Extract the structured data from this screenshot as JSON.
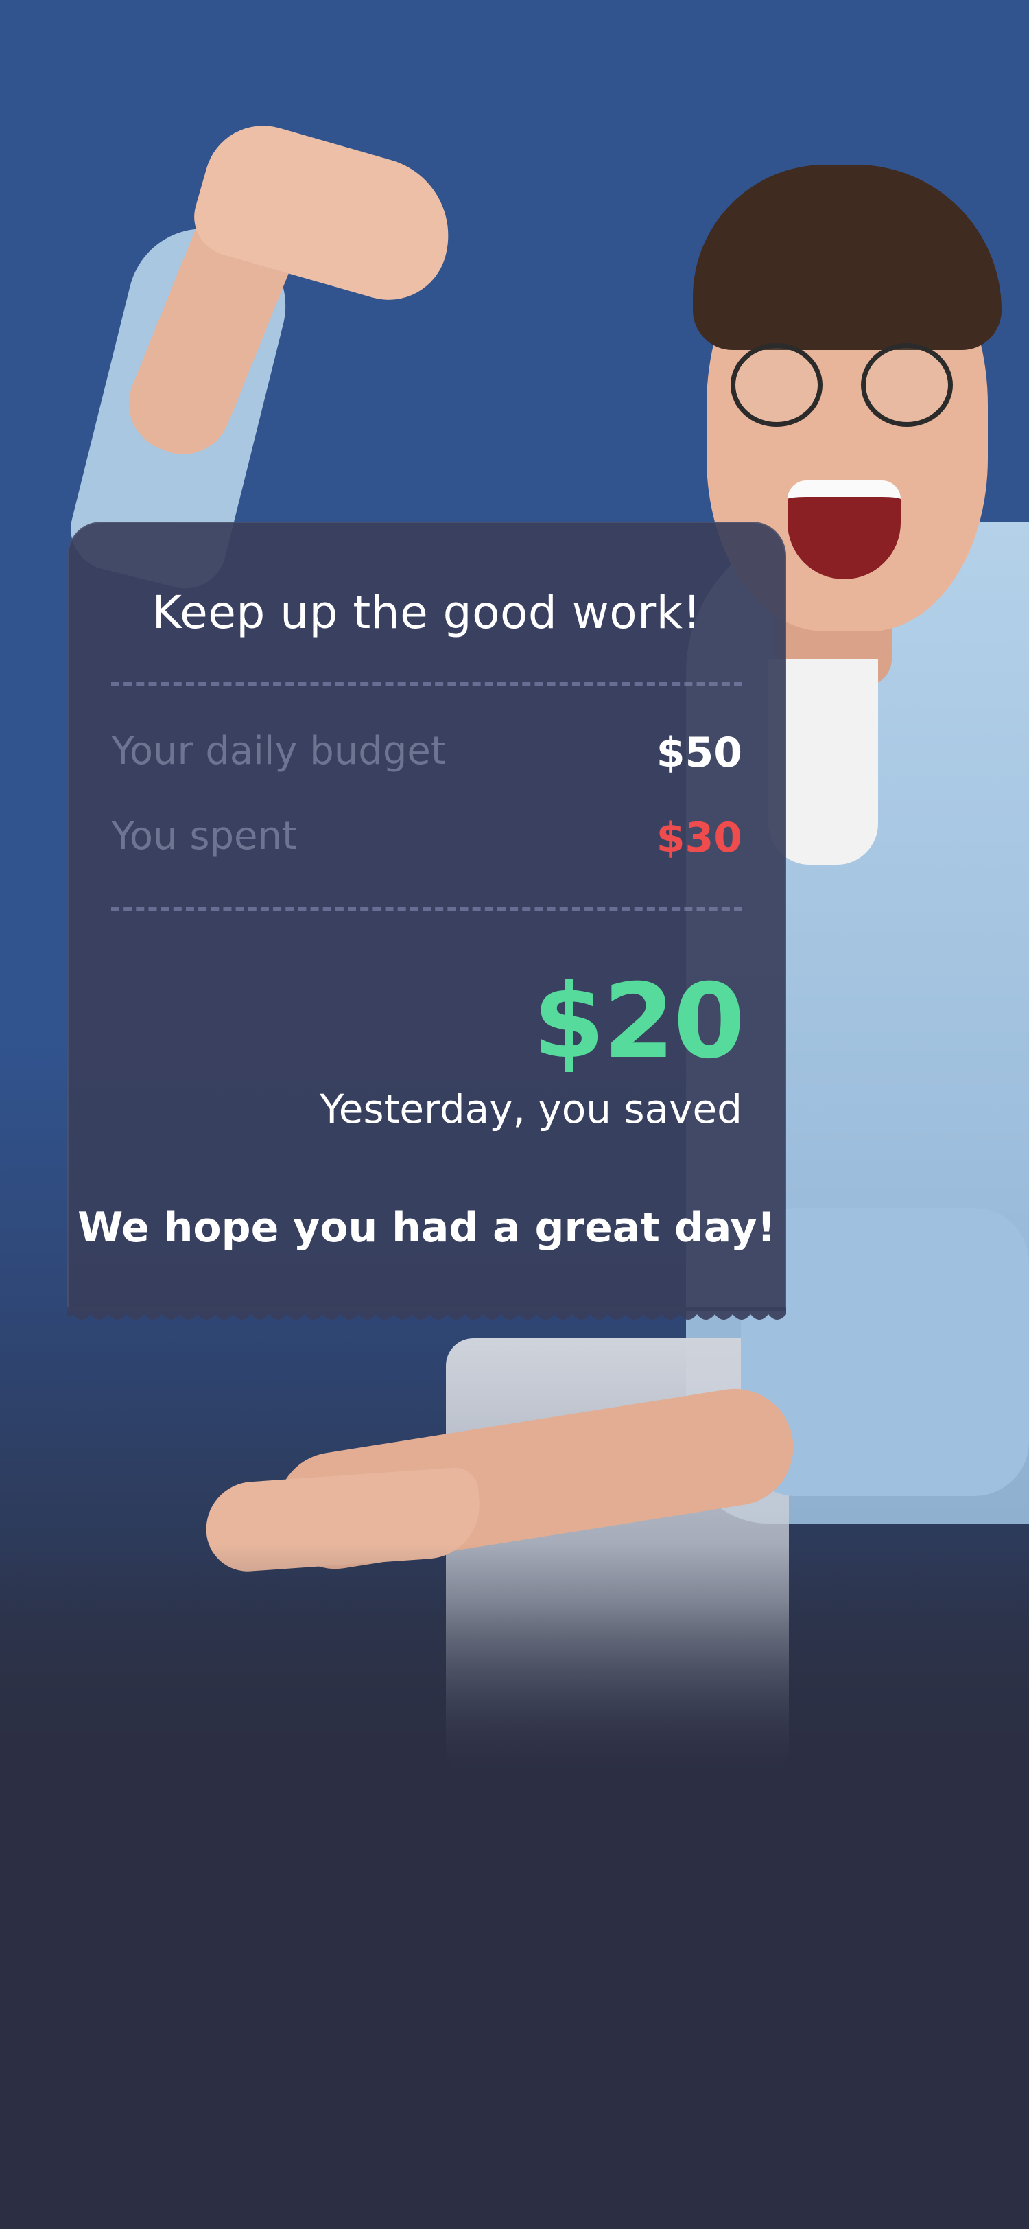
{
  "card": {
    "title": "Keep up the good work!",
    "budget_label": "Your daily budget",
    "budget_value": "$50",
    "spent_label": "You spent",
    "spent_value": "$30",
    "saved_amount": "$20",
    "saved_label": "Yesterday, you saved",
    "closing_message": "We hope you had a great day!"
  },
  "colors": {
    "background_top": "#31548f",
    "background_bottom": "#2c2f44",
    "card": "#3a3f5c",
    "spent": "#ef4d4d",
    "saved": "#56db9c",
    "muted_label": "#6e7592"
  }
}
